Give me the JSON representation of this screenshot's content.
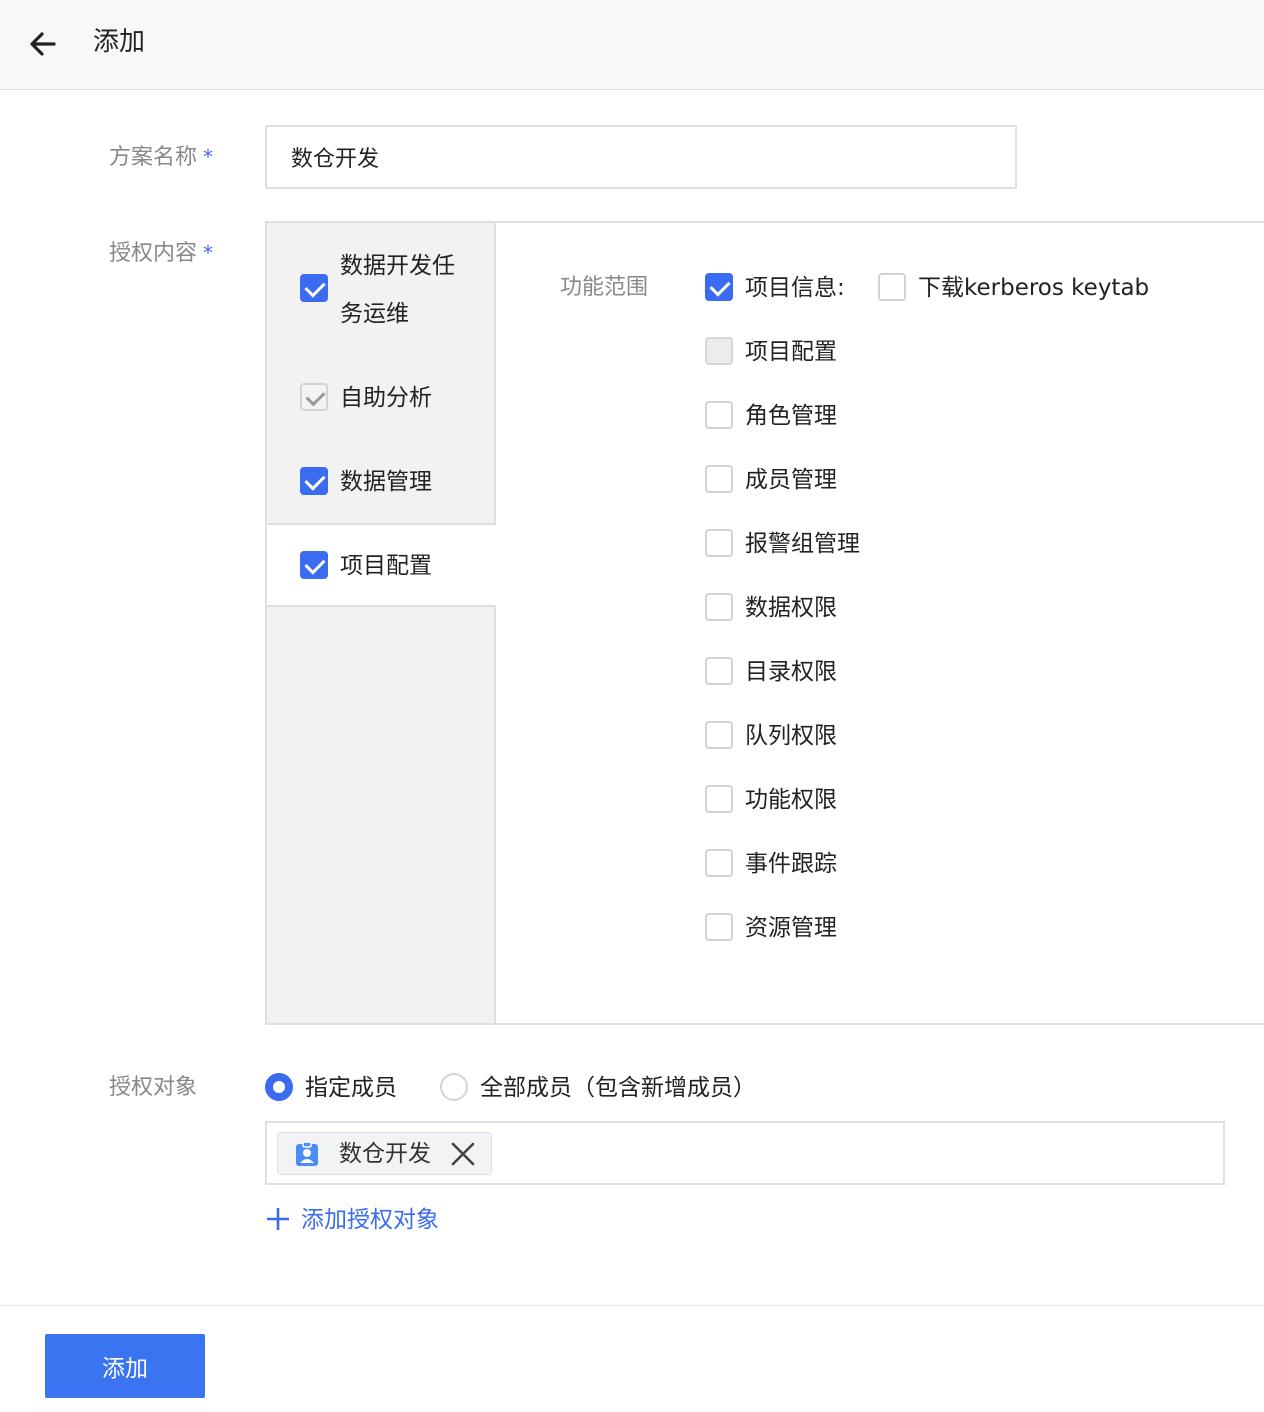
{
  "header": {
    "title": "添加",
    "back_icon": "arrow-left-icon"
  },
  "form": {
    "scheme_name": {
      "label": "方案名称",
      "required_mark": "*",
      "value": "数仓开发"
    },
    "auth_content": {
      "label": "授权内容",
      "required_mark": "*",
      "modules": [
        {
          "label_line1": "数据开发任",
          "label_line2": "务运维",
          "state": "checked"
        },
        {
          "label": "自助分析",
          "state": "checked-disabled"
        },
        {
          "label": "数据管理",
          "state": "checked"
        },
        {
          "label": "项目配置",
          "state": "checked",
          "active": true
        }
      ],
      "scope_label": "功能范围",
      "scope_items": [
        {
          "label": "项目信息:",
          "state": "checked"
        },
        {
          "label": "下载kerberos keytab",
          "state": "unchecked"
        },
        {
          "label": "项目配置",
          "state": "disabled"
        },
        {
          "label": "角色管理",
          "state": "unchecked"
        },
        {
          "label": "成员管理",
          "state": "unchecked"
        },
        {
          "label": "报警组管理",
          "state": "unchecked"
        },
        {
          "label": "数据权限",
          "state": "unchecked"
        },
        {
          "label": "目录权限",
          "state": "unchecked"
        },
        {
          "label": "队列权限",
          "state": "unchecked"
        },
        {
          "label": "功能权限",
          "state": "unchecked"
        },
        {
          "label": "事件跟踪",
          "state": "unchecked"
        },
        {
          "label": "资源管理",
          "state": "unchecked"
        }
      ]
    },
    "auth_target": {
      "label": "授权对象",
      "options": [
        {
          "label": "指定成员",
          "selected": true
        },
        {
          "label": "全部成员（包含新增成员）",
          "selected": false
        }
      ],
      "tags": [
        {
          "label": "数仓开发",
          "icon": "member-badge-icon"
        }
      ],
      "add_link": "添加授权对象"
    }
  },
  "footer": {
    "submit_label": "添加"
  },
  "colors": {
    "accent": "#3a6bf0",
    "primary_button": "#3a74f0"
  }
}
